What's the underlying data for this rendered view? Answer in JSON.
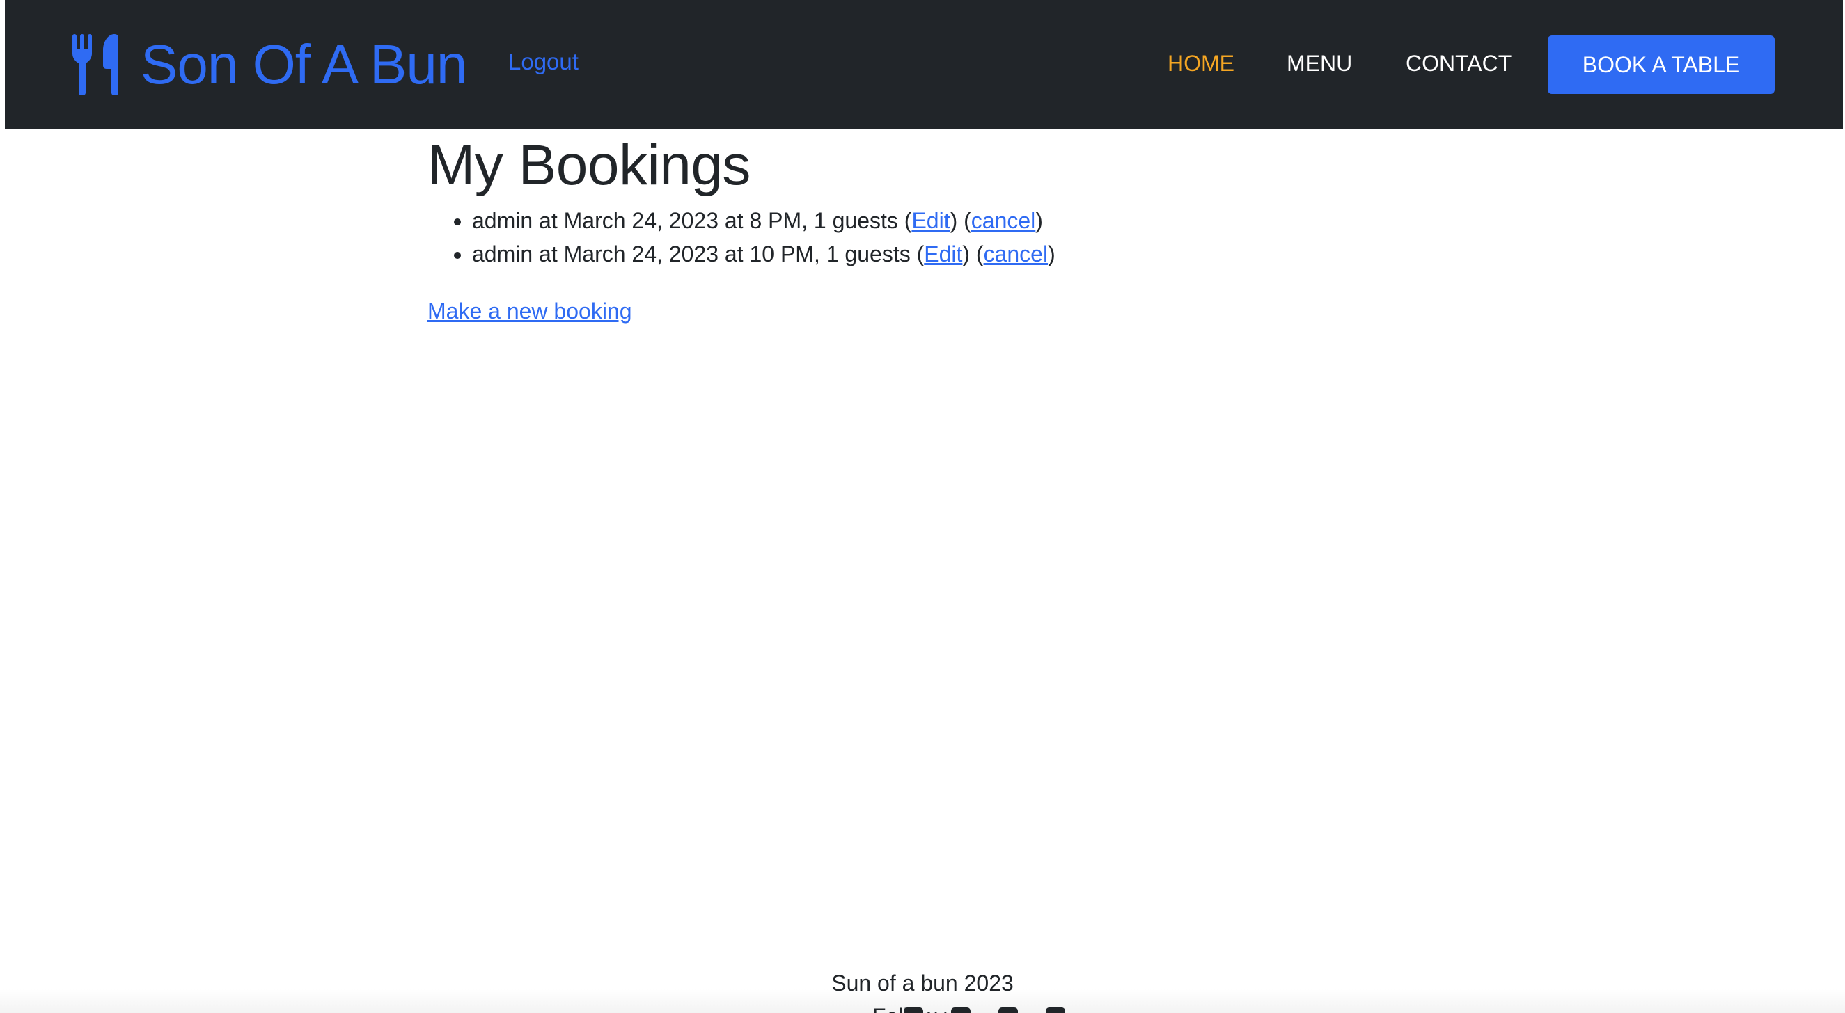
{
  "navbar": {
    "brand_name": "Son Of A Bun",
    "brand_icon": "utensils-icon",
    "logout_label": "Logout",
    "links": [
      {
        "label": "HOME",
        "active": true
      },
      {
        "label": "MENU",
        "active": false
      },
      {
        "label": "CONTACT",
        "active": false
      }
    ],
    "book_button_label": "BOOK A TABLE",
    "colors": {
      "background": "#212529",
      "brand": "#2f6bf3",
      "active_link": "#f5a623",
      "link": "#ffffff",
      "button": "#2f6bf3"
    }
  },
  "main": {
    "title": "My Bookings",
    "bookings": [
      {
        "text": "admin at March 24, 2023 at 8 PM, 1 guests",
        "edit_label": "Edit",
        "cancel_label": "cancel"
      },
      {
        "text": "admin at March 24, 2023 at 10 PM, 1 guests",
        "edit_label": "Edit",
        "cancel_label": "cancel"
      }
    ],
    "new_booking_label": "Make a new booking"
  },
  "footer": {
    "copyright": "Sun of a bun 2023",
    "follow_label": "Follow us:",
    "social_icons": [
      "facebook-icon",
      "twitter-icon",
      "instagram-icon",
      "youtube-icon"
    ]
  }
}
